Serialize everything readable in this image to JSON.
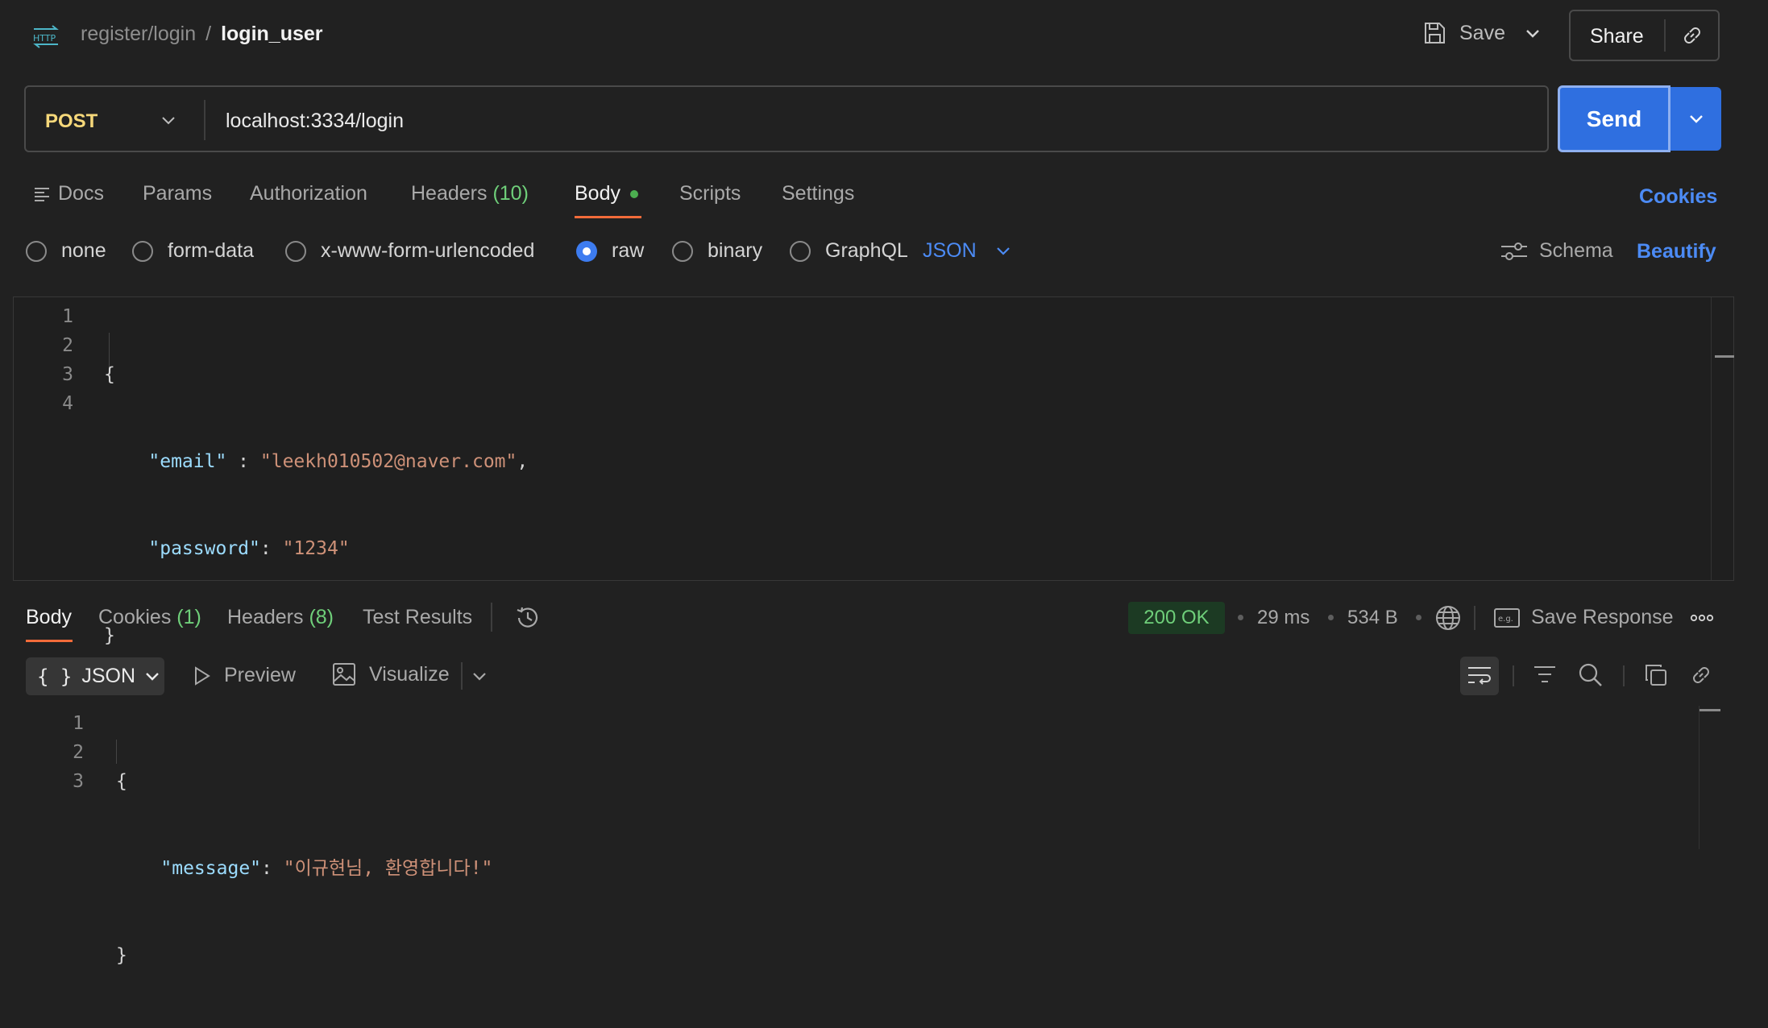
{
  "header": {
    "breadcrumb_parent": "register/login",
    "breadcrumb_sep": "/",
    "breadcrumb_current": "login_user",
    "save_label": "Save",
    "share_label": "Share"
  },
  "request": {
    "method": "POST",
    "url": "localhost:3334/login",
    "send_label": "Send"
  },
  "tabs": {
    "docs": "Docs",
    "params": "Params",
    "authorization": "Authorization",
    "headers": "Headers",
    "headers_count": "(10)",
    "body": "Body",
    "scripts": "Scripts",
    "settings": "Settings",
    "cookies": "Cookies"
  },
  "body_types": {
    "none": "none",
    "form_data": "form-data",
    "urlencoded": "x-www-form-urlencoded",
    "raw": "raw",
    "binary": "binary",
    "graphql": "GraphQL",
    "format": "JSON",
    "schema": "Schema",
    "beautify": "Beautify"
  },
  "editor": {
    "line_numbers": [
      "1",
      "2",
      "3",
      "4"
    ],
    "open_brace": "{",
    "close_brace": "}",
    "email_key": "\"email\"",
    "email_sep": " : ",
    "email_value": "\"leekh010502@naver.com\"",
    "comma": ",",
    "password_key": "\"password\"",
    "password_sep": ": ",
    "password_value": "\"1234\""
  },
  "response": {
    "tabs": {
      "body": "Body",
      "cookies": "Cookies",
      "cookies_count": "(1)",
      "headers": "Headers",
      "headers_count": "(8)",
      "test_results": "Test Results"
    },
    "status": "200 OK",
    "time": "29 ms",
    "size": "534 B",
    "save_response": "Save Response",
    "format_label": "JSON",
    "preview": "Preview",
    "visualize": "Visualize",
    "line_numbers": [
      "1",
      "2",
      "3"
    ],
    "open_brace": "{",
    "close_brace": "}",
    "message_key": "\"message\"",
    "message_sep": ": ",
    "message_value": "\"이규현님, 환영합니다!\""
  },
  "colors": {
    "accent_blue": "#2f6fe0",
    "tab_underline": "#f26b3a",
    "status_green": "#6fcf7a",
    "method_yellow": "#f6d87a"
  }
}
